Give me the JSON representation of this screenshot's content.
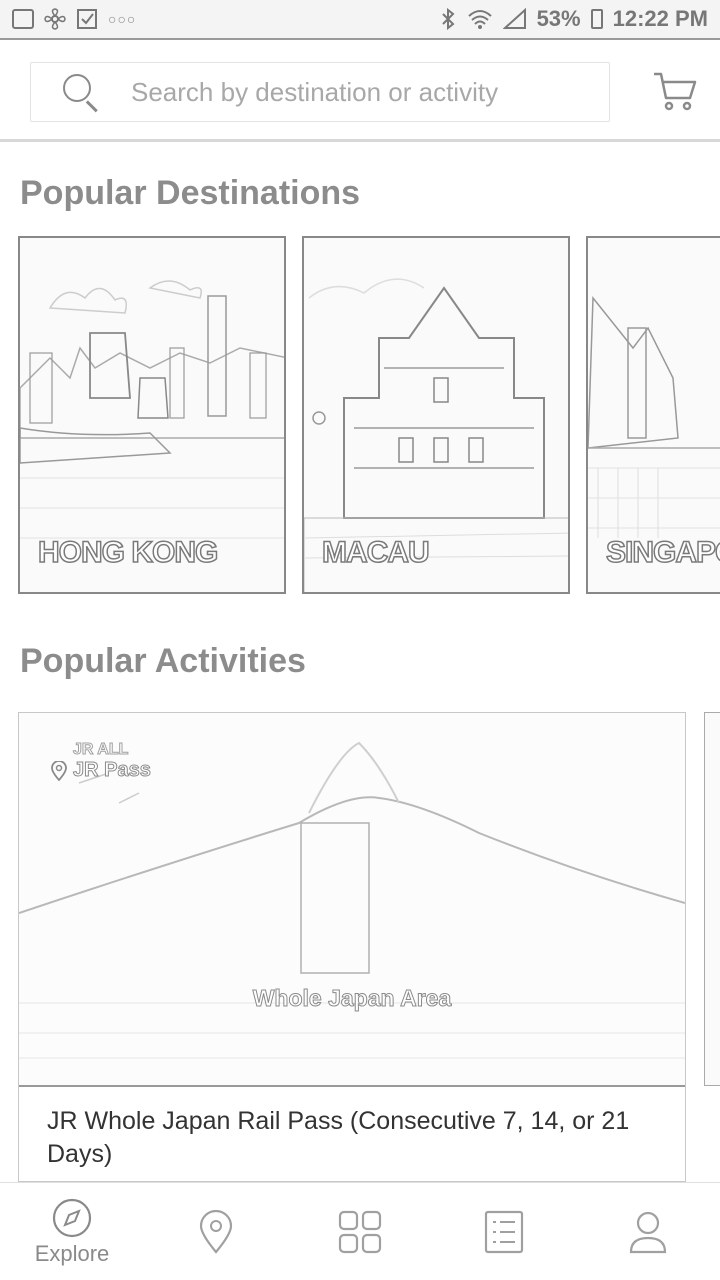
{
  "status_bar": {
    "battery": "53%",
    "time": "12:22 PM"
  },
  "search": {
    "placeholder": "Search by destination or activity"
  },
  "sections": {
    "destinations_title": "Popular Destinations",
    "activities_title": "Popular Activities"
  },
  "destinations": [
    {
      "label": "HONG KONG"
    },
    {
      "label": "MACAU"
    },
    {
      "label": "SINGAPORE"
    }
  ],
  "activities": [
    {
      "region": "JR ALL",
      "pass": "JR Pass",
      "image_caption": "Whole Japan Area",
      "title": "JR Whole Japan Rail Pass (Consecutive 7, 14, or 21 Days)"
    }
  ],
  "bottom_nav": {
    "items": [
      {
        "label": "Explore",
        "icon": "compass-icon",
        "active": true
      },
      {
        "label": "",
        "icon": "location-pin-icon",
        "active": false
      },
      {
        "label": "",
        "icon": "grid-icon",
        "active": false
      },
      {
        "label": "",
        "icon": "list-icon",
        "active": false
      },
      {
        "label": "",
        "icon": "profile-icon",
        "active": false
      }
    ]
  }
}
